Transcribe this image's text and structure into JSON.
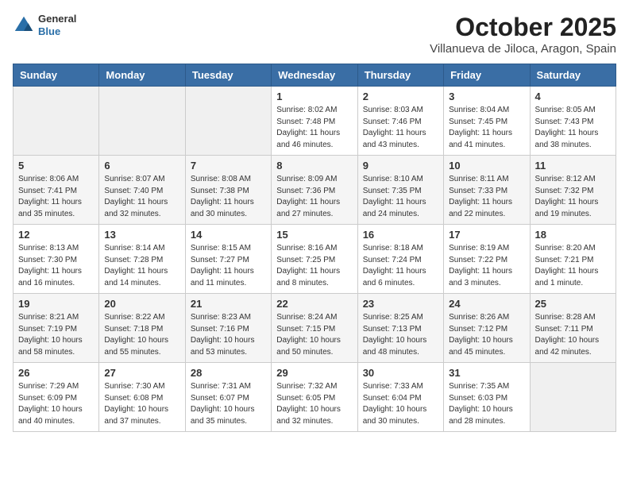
{
  "header": {
    "logo_general": "General",
    "logo_blue": "Blue",
    "month": "October 2025",
    "location": "Villanueva de Jiloca, Aragon, Spain"
  },
  "weekdays": [
    "Sunday",
    "Monday",
    "Tuesday",
    "Wednesday",
    "Thursday",
    "Friday",
    "Saturday"
  ],
  "weeks": [
    [
      {
        "day": "",
        "content": ""
      },
      {
        "day": "",
        "content": ""
      },
      {
        "day": "",
        "content": ""
      },
      {
        "day": "1",
        "content": "Sunrise: 8:02 AM\nSunset: 7:48 PM\nDaylight: 11 hours\nand 46 minutes."
      },
      {
        "day": "2",
        "content": "Sunrise: 8:03 AM\nSunset: 7:46 PM\nDaylight: 11 hours\nand 43 minutes."
      },
      {
        "day": "3",
        "content": "Sunrise: 8:04 AM\nSunset: 7:45 PM\nDaylight: 11 hours\nand 41 minutes."
      },
      {
        "day": "4",
        "content": "Sunrise: 8:05 AM\nSunset: 7:43 PM\nDaylight: 11 hours\nand 38 minutes."
      }
    ],
    [
      {
        "day": "5",
        "content": "Sunrise: 8:06 AM\nSunset: 7:41 PM\nDaylight: 11 hours\nand 35 minutes."
      },
      {
        "day": "6",
        "content": "Sunrise: 8:07 AM\nSunset: 7:40 PM\nDaylight: 11 hours\nand 32 minutes."
      },
      {
        "day": "7",
        "content": "Sunrise: 8:08 AM\nSunset: 7:38 PM\nDaylight: 11 hours\nand 30 minutes."
      },
      {
        "day": "8",
        "content": "Sunrise: 8:09 AM\nSunset: 7:36 PM\nDaylight: 11 hours\nand 27 minutes."
      },
      {
        "day": "9",
        "content": "Sunrise: 8:10 AM\nSunset: 7:35 PM\nDaylight: 11 hours\nand 24 minutes."
      },
      {
        "day": "10",
        "content": "Sunrise: 8:11 AM\nSunset: 7:33 PM\nDaylight: 11 hours\nand 22 minutes."
      },
      {
        "day": "11",
        "content": "Sunrise: 8:12 AM\nSunset: 7:32 PM\nDaylight: 11 hours\nand 19 minutes."
      }
    ],
    [
      {
        "day": "12",
        "content": "Sunrise: 8:13 AM\nSunset: 7:30 PM\nDaylight: 11 hours\nand 16 minutes."
      },
      {
        "day": "13",
        "content": "Sunrise: 8:14 AM\nSunset: 7:28 PM\nDaylight: 11 hours\nand 14 minutes."
      },
      {
        "day": "14",
        "content": "Sunrise: 8:15 AM\nSunset: 7:27 PM\nDaylight: 11 hours\nand 11 minutes."
      },
      {
        "day": "15",
        "content": "Sunrise: 8:16 AM\nSunset: 7:25 PM\nDaylight: 11 hours\nand 8 minutes."
      },
      {
        "day": "16",
        "content": "Sunrise: 8:18 AM\nSunset: 7:24 PM\nDaylight: 11 hours\nand 6 minutes."
      },
      {
        "day": "17",
        "content": "Sunrise: 8:19 AM\nSunset: 7:22 PM\nDaylight: 11 hours\nand 3 minutes."
      },
      {
        "day": "18",
        "content": "Sunrise: 8:20 AM\nSunset: 7:21 PM\nDaylight: 11 hours\nand 1 minute."
      }
    ],
    [
      {
        "day": "19",
        "content": "Sunrise: 8:21 AM\nSunset: 7:19 PM\nDaylight: 10 hours\nand 58 minutes."
      },
      {
        "day": "20",
        "content": "Sunrise: 8:22 AM\nSunset: 7:18 PM\nDaylight: 10 hours\nand 55 minutes."
      },
      {
        "day": "21",
        "content": "Sunrise: 8:23 AM\nSunset: 7:16 PM\nDaylight: 10 hours\nand 53 minutes."
      },
      {
        "day": "22",
        "content": "Sunrise: 8:24 AM\nSunset: 7:15 PM\nDaylight: 10 hours\nand 50 minutes."
      },
      {
        "day": "23",
        "content": "Sunrise: 8:25 AM\nSunset: 7:13 PM\nDaylight: 10 hours\nand 48 minutes."
      },
      {
        "day": "24",
        "content": "Sunrise: 8:26 AM\nSunset: 7:12 PM\nDaylight: 10 hours\nand 45 minutes."
      },
      {
        "day": "25",
        "content": "Sunrise: 8:28 AM\nSunset: 7:11 PM\nDaylight: 10 hours\nand 42 minutes."
      }
    ],
    [
      {
        "day": "26",
        "content": "Sunrise: 7:29 AM\nSunset: 6:09 PM\nDaylight: 10 hours\nand 40 minutes."
      },
      {
        "day": "27",
        "content": "Sunrise: 7:30 AM\nSunset: 6:08 PM\nDaylight: 10 hours\nand 37 minutes."
      },
      {
        "day": "28",
        "content": "Sunrise: 7:31 AM\nSunset: 6:07 PM\nDaylight: 10 hours\nand 35 minutes."
      },
      {
        "day": "29",
        "content": "Sunrise: 7:32 AM\nSunset: 6:05 PM\nDaylight: 10 hours\nand 32 minutes."
      },
      {
        "day": "30",
        "content": "Sunrise: 7:33 AM\nSunset: 6:04 PM\nDaylight: 10 hours\nand 30 minutes."
      },
      {
        "day": "31",
        "content": "Sunrise: 7:35 AM\nSunset: 6:03 PM\nDaylight: 10 hours\nand 28 minutes."
      },
      {
        "day": "",
        "content": ""
      }
    ]
  ]
}
